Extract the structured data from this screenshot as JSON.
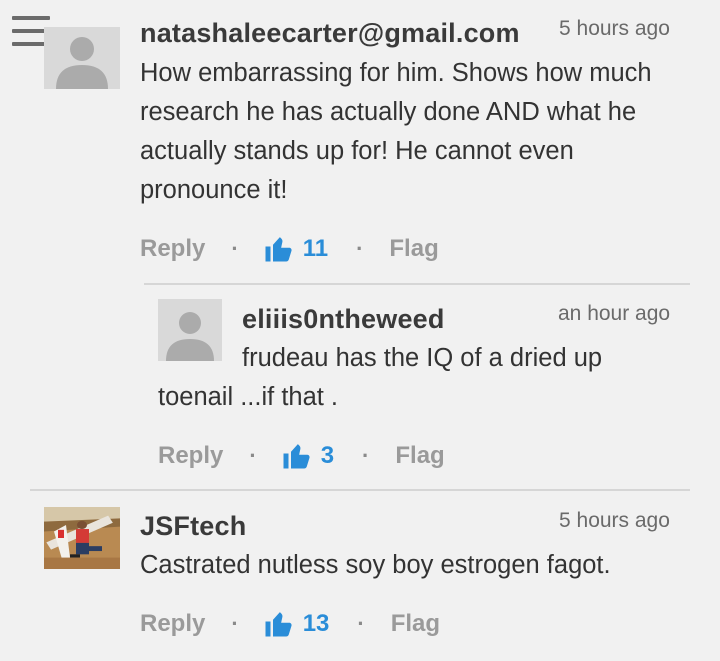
{
  "comments": [
    {
      "username": "natashaleecarter@gmail.com",
      "time": "5 hours ago",
      "text": "How embarrassing for him. Shows how much research he has actually done AND what he actually stands up for! He cannot even pronounce it!",
      "reply_label": "Reply",
      "likes": "11",
      "flag_label": "Flag"
    },
    {
      "username": "eliiis0ntheweed",
      "time": "an hour ago",
      "text": "frudeau has the IQ of a dried up toenail ...if that .",
      "reply_label": "Reply",
      "likes": "3",
      "flag_label": "Flag"
    },
    {
      "username": "JSFtech",
      "time": "5 hours ago",
      "text": "Castrated nutless soy boy estrogen fagot.",
      "reply_label": "Reply",
      "likes": "13",
      "flag_label": "Flag"
    }
  ],
  "separator": "·",
  "colors": {
    "like_blue": "#2a8dd8",
    "background": "#f1f1f1",
    "muted": "#9a9a9a"
  },
  "icons": {
    "menu": "hamburger-menu-icon",
    "like": "thumbs-up-icon",
    "avatar": "default-user-avatar"
  }
}
